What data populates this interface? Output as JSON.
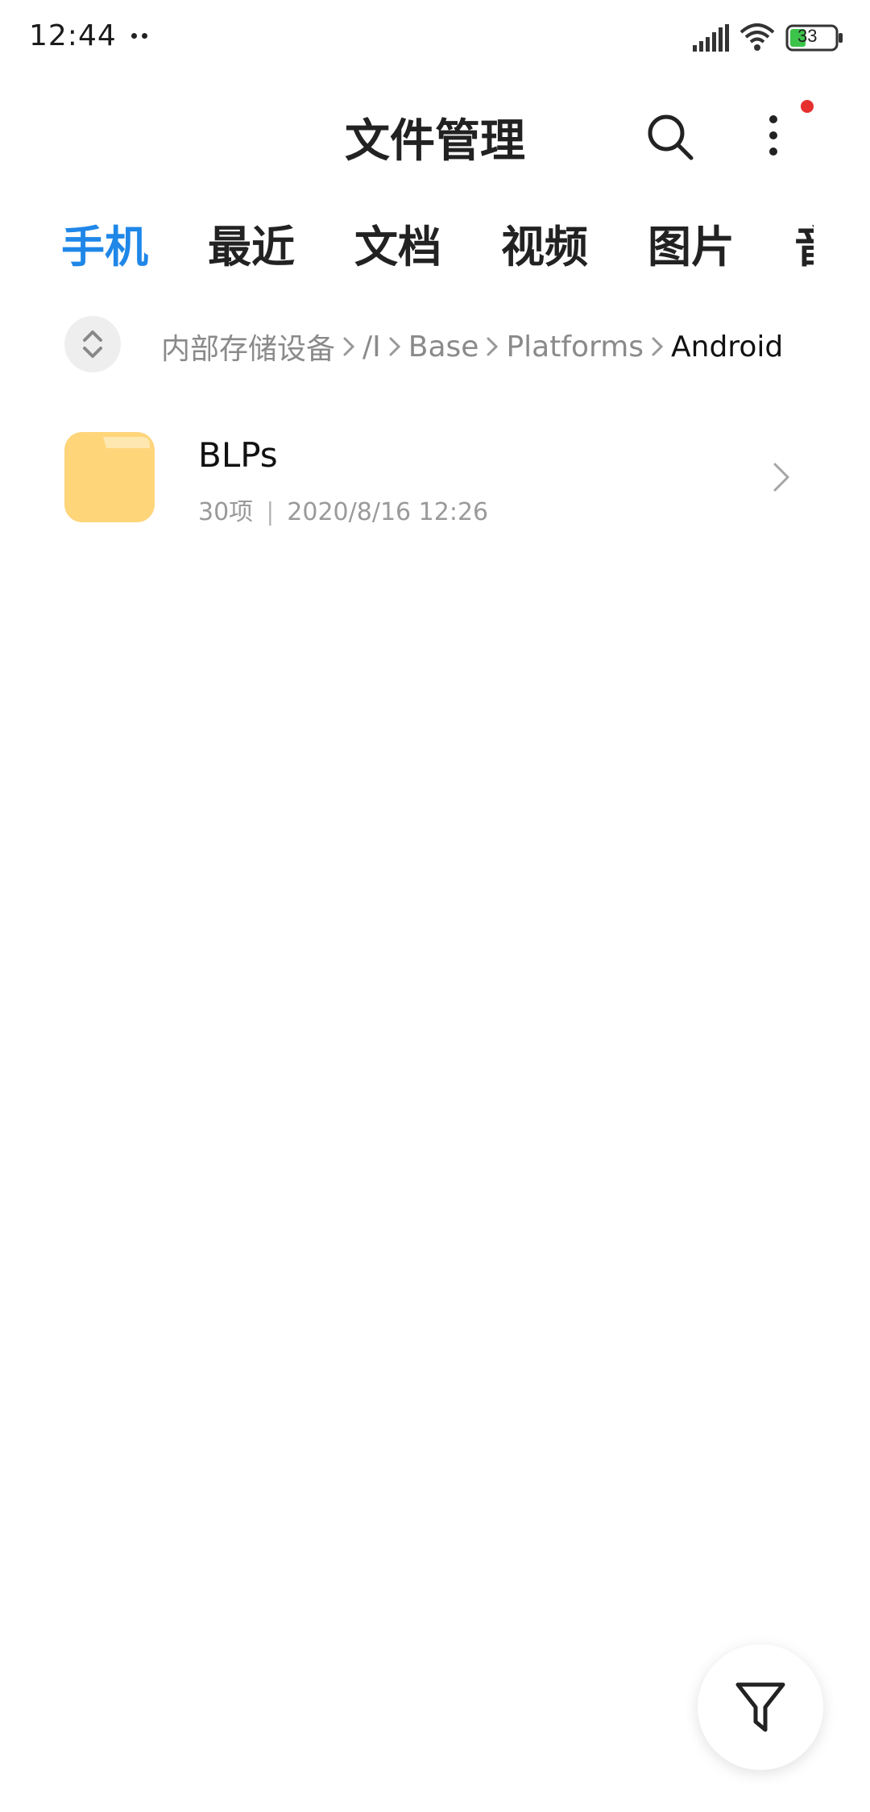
{
  "status_bar": {
    "time": "12:44",
    "battery_level": "33",
    "icons": [
      "signal-icon",
      "wifi-icon",
      "battery-icon"
    ]
  },
  "header": {
    "title": "文件管理",
    "actions": [
      "search-icon",
      "more-vertical-icon"
    ],
    "notification_dot": true
  },
  "tabs": [
    {
      "label": "手机",
      "active": true
    },
    {
      "label": "最近",
      "active": false
    },
    {
      "label": "文档",
      "active": false
    },
    {
      "label": "视频",
      "active": false
    },
    {
      "label": "图片",
      "active": false
    },
    {
      "label": "音",
      "active": false
    }
  ],
  "breadcrumb": {
    "items": [
      "内部存储设备",
      "/I",
      "Base",
      "Platforms",
      "Android"
    ],
    "current": "Android"
  },
  "files": [
    {
      "name": "BLPs",
      "count": "30项",
      "separator": "|",
      "modified": "2020/8/16 12:26",
      "type": "folder"
    }
  ],
  "fab": {
    "icon": "filter-icon"
  },
  "colors": {
    "accent": "#1f87e8",
    "folder": "#ffd57a",
    "notification": "#e5302e",
    "battery": "#3cc34a"
  }
}
